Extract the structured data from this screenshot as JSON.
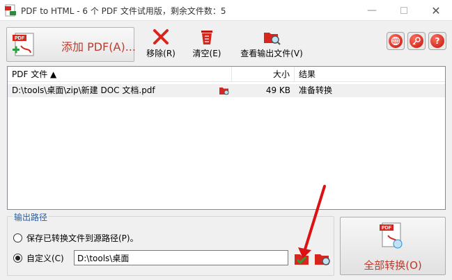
{
  "window": {
    "title": "PDF to HTML - 6 个 PDF 文件试用版，剩余文件数：5"
  },
  "toolbar": {
    "add_pdf_label": "添加 PDF(A)...",
    "remove_label": "移除(R)",
    "clear_label": "清空(E)",
    "view_output_label": "查看输出文件(V)"
  },
  "file_list": {
    "columns": [
      "PDF 文件 ▲",
      "大小",
      "结果"
    ],
    "rows": [
      {
        "file": "D:\\tools\\桌面\\zip\\新建 DOC 文档.pdf",
        "size": "49 KB",
        "status": "准备转换"
      }
    ]
  },
  "output": {
    "group_title": "输出路径",
    "option_source_label": "保存已转换文件到源路径(P)。",
    "option_custom_label": "自定义(C)",
    "selected": "custom",
    "path_value": "D:\\tools\\桌面"
  },
  "convert": {
    "label": "全部转换(O)"
  },
  "colors": {
    "accent_red": "#c0392b",
    "link_blue": "#1f5ea8"
  }
}
